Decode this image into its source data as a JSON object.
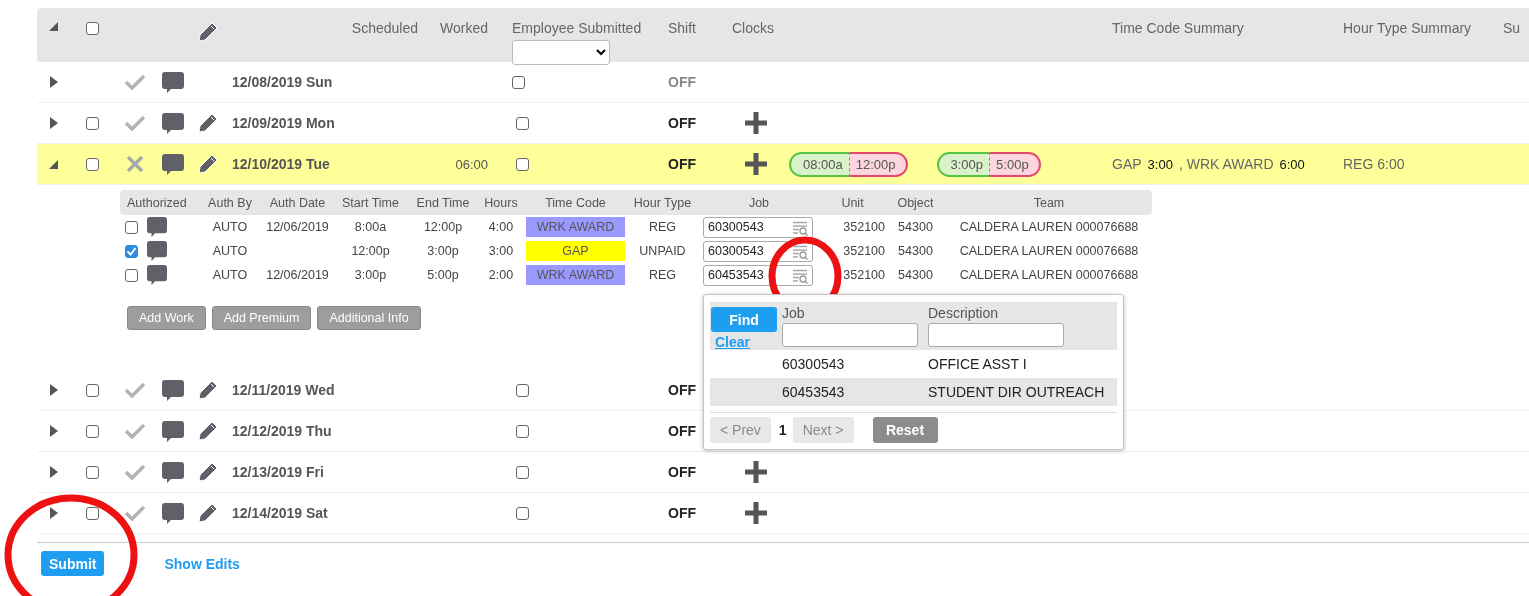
{
  "header": {
    "expand_all_expanded": true,
    "select_all_checked": false,
    "columns": {
      "scheduled": "Scheduled",
      "worked": "Worked",
      "employee_submitted": "Employee Submitted",
      "shift": "Shift",
      "clocks": "Clocks",
      "time_code_summary": "Time Code Summary",
      "hour_type_summary": "Hour Type Summary",
      "column_14": "Su"
    }
  },
  "days": [
    {
      "date": "12/08/2019 Sun",
      "expanded": false,
      "selectable": false,
      "rejected": false,
      "editable": false,
      "employee_submitted": false,
      "shift": "OFF",
      "can_add_clock": false
    },
    {
      "date": "12/09/2019 Mon",
      "expanded": false,
      "selectable": true,
      "checked": false,
      "rejected": false,
      "editable": true,
      "employee_submitted": false,
      "shift": "OFF",
      "can_add_clock": true
    },
    {
      "date": "12/10/2019 Tue",
      "expanded": true,
      "selectable": true,
      "checked": false,
      "rejected": true,
      "editable": true,
      "worked": "06:00",
      "employee_submitted": false,
      "shift": "OFF",
      "can_add_clock": true,
      "clocks": [
        {
          "in": "08:00a",
          "out": "12:00p"
        },
        {
          "in": "3:00p",
          "out": "5:00p"
        }
      ],
      "time_code_summary": [
        {
          "code": "GAP",
          "hours": "3:00"
        },
        {
          "code": ", WRK AWARD",
          "hours": "6:00"
        }
      ],
      "hour_type_summary": "REG 6:00",
      "details": {
        "columns": [
          "Authorized",
          "Auth By",
          "Auth Date",
          "Start Time",
          "End Time",
          "Hours",
          "Time Code",
          "Hour Type",
          "Job",
          "Unit",
          "Object",
          "Team"
        ],
        "entries": [
          {
            "authorized": false,
            "auth_by": "AUTO",
            "auth_date": "12/06/2019",
            "start": "8:00a",
            "end": "12:00p",
            "hours": "4:00",
            "time_code": "WRK AWARD",
            "color": "#9999ff",
            "hour_type": "REG",
            "job": "60300543",
            "job_circled": false,
            "unit": "352100",
            "object": "54300",
            "team": "CALDERA LAUREN 000076688"
          },
          {
            "authorized": true,
            "auth_by": "AUTO",
            "start": "12:00p",
            "end": "3:00p",
            "hours": "3:00",
            "time_code": "GAP",
            "color": "#ffff00",
            "hour_type": "UNPAID",
            "job": "60300543",
            "job_circled": false,
            "unit": "352100",
            "object": "54300",
            "team": "CALDERA LAUREN 000076688"
          },
          {
            "authorized": false,
            "auth_by": "AUTO",
            "auth_date": "12/06/2019",
            "start": "3:00p",
            "end": "5:00p",
            "hours": "2:00",
            "time_code": "WRK AWARD",
            "color": "#9999ff",
            "hour_type": "REG",
            "job": "60453543",
            "job_circled": true,
            "unit": "352100",
            "object": "54300",
            "team": "CALDERA LAUREN 000076688"
          }
        ],
        "buttons": [
          "Add Work",
          "Add Premium",
          "Additional Info"
        ],
        "job_lookup": {
          "find": "Find",
          "clear": "Clear",
          "columns": [
            "Job",
            "Description"
          ],
          "results": [
            {
              "job": "60300543",
              "description": "OFFICE ASST I",
              "selected": false
            },
            {
              "job": "60453543",
              "description": "STUDENT DIR OUTREACH",
              "selected": true
            }
          ],
          "pager": {
            "prev": "< Prev",
            "prev_disabled": true,
            "page": "1",
            "next": "Next >",
            "next_disabled": true
          },
          "reset": "Reset"
        }
      }
    },
    {
      "date": "12/11/2019 Wed",
      "expanded": false,
      "selectable": true,
      "checked": false,
      "rejected": false,
      "editable": true,
      "employee_submitted": false,
      "shift": "OFF"
    },
    {
      "date": "12/12/2019 Thu",
      "expanded": false,
      "selectable": true,
      "checked": false,
      "rejected": false,
      "editable": true,
      "employee_submitted": false,
      "shift": "OFF"
    },
    {
      "date": "12/13/2019 Fri",
      "expanded": false,
      "selectable": true,
      "checked": false,
      "rejected": false,
      "editable": true,
      "employee_submitted": false,
      "shift": "OFF",
      "can_add_clock": true
    },
    {
      "date": "12/14/2019 Sat",
      "expanded": false,
      "selectable": true,
      "checked": false,
      "rejected": false,
      "editable": true,
      "employee_submitted": false,
      "shift": "OFF",
      "can_add_clock": true
    }
  ],
  "footer": {
    "submit": "Submit",
    "submit_circled": true,
    "show_edits": "Show Edits"
  }
}
